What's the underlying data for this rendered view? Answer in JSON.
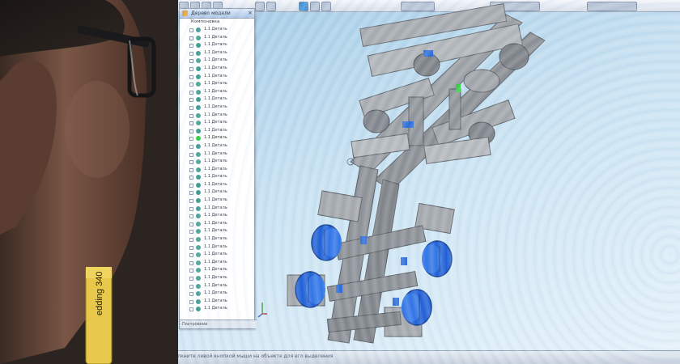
{
  "scene": {
    "description_tag": "photo-of-monitor"
  },
  "app": {
    "tree_panel": {
      "title": "Дерево модели",
      "close_glyph": "×",
      "root_label": "Компоновка",
      "items": [
        {
          "label": "1.1 Деталь",
          "selected": false
        },
        {
          "label": "1.1 Деталь",
          "selected": false
        },
        {
          "label": "1.1 Деталь",
          "selected": false
        },
        {
          "label": "1.1 Деталь",
          "selected": false
        },
        {
          "label": "1.1 Деталь",
          "selected": false
        },
        {
          "label": "1.1 Деталь",
          "selected": false
        },
        {
          "label": "1.1 Деталь",
          "selected": false
        },
        {
          "label": "1.1 Деталь",
          "selected": false
        },
        {
          "label": "1.1 Деталь",
          "selected": false
        },
        {
          "label": "1.1 Деталь",
          "selected": false
        },
        {
          "label": "1.1 Деталь",
          "selected": false
        },
        {
          "label": "1.1 Деталь",
          "selected": false
        },
        {
          "label": "1.1 Деталь",
          "selected": false
        },
        {
          "label": "1.1 Деталь",
          "selected": false
        },
        {
          "label": "1.1 Деталь",
          "selected": true
        },
        {
          "label": "1.1 Деталь",
          "selected": false
        },
        {
          "label": "1.1 Деталь",
          "selected": false
        },
        {
          "label": "1.1 Деталь",
          "selected": false
        },
        {
          "label": "1.1 Деталь",
          "selected": false
        },
        {
          "label": "1.1 Деталь",
          "selected": false
        },
        {
          "label": "1.1 Деталь",
          "selected": false
        },
        {
          "label": "1.1 Деталь",
          "selected": false
        },
        {
          "label": "1.1 Деталь",
          "selected": false
        },
        {
          "label": "1.1 Деталь",
          "selected": false
        },
        {
          "label": "1.1 Деталь",
          "selected": false
        },
        {
          "label": "1.1 Деталь",
          "selected": false
        },
        {
          "label": "1.1 Деталь",
          "selected": false
        },
        {
          "label": "1.1 Деталь",
          "selected": false
        },
        {
          "label": "1.1 Деталь",
          "selected": false
        },
        {
          "label": "1.1 Деталь",
          "selected": false
        },
        {
          "label": "1.1 Деталь",
          "selected": false
        },
        {
          "label": "1.1 Деталь",
          "selected": false
        },
        {
          "label": "1.1 Деталь",
          "selected": false
        },
        {
          "label": "1.1 Деталь",
          "selected": false
        },
        {
          "label": "1.1 Деталь",
          "selected": false
        },
        {
          "label": "1.1 Деталь",
          "selected": false
        },
        {
          "label": "1.1 Деталь",
          "selected": false
        }
      ],
      "footer_label": "Построение"
    },
    "status": {
      "text": "Щелкните левой кнопкой мыши на объекте для его выделения"
    },
    "marker_label": "edding 340"
  },
  "colors": {
    "wheel_blue": "#1e5fd6",
    "chassis_gray": "#8c8f93",
    "selected_part": "#2ccf3a",
    "part_icon": "#3a9a8e",
    "screen_bg": "#c8e2f2",
    "marker_yellow": "#e8c84a"
  }
}
